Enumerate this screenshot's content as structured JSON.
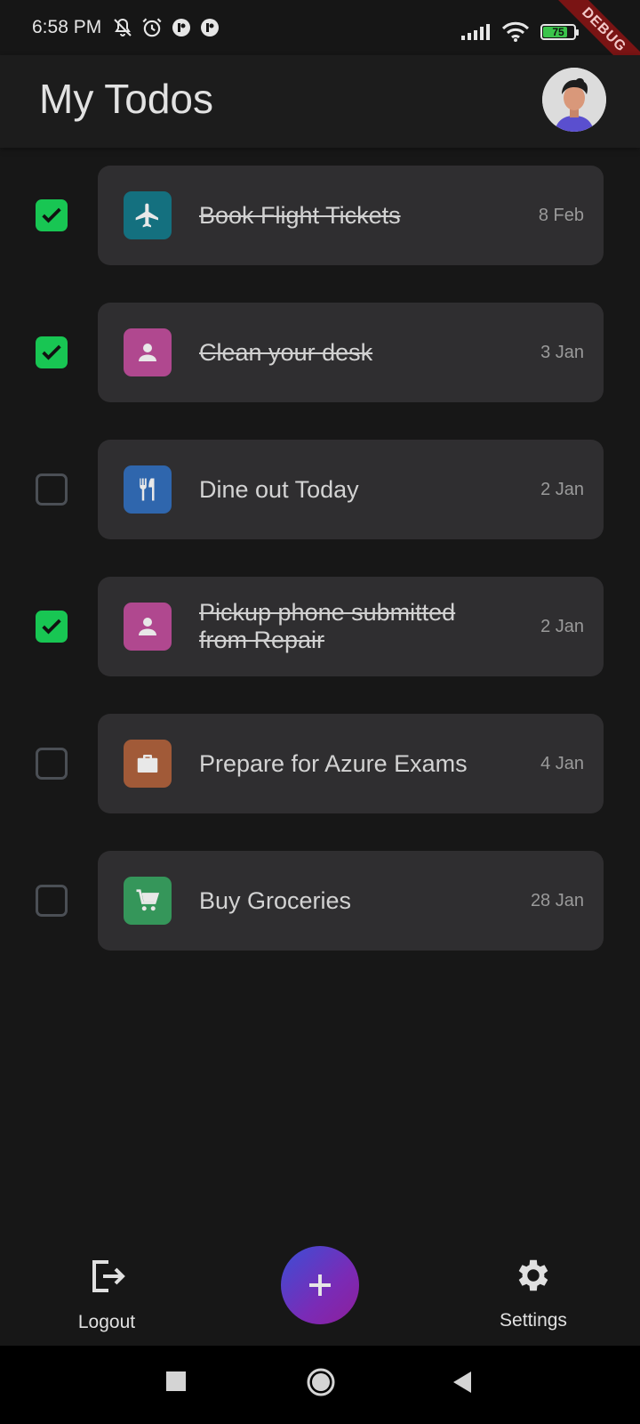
{
  "status_bar": {
    "time": "6:58 PM",
    "battery_level": "75",
    "battery_fraction": 0.75,
    "icons_left": [
      "bell-off-icon",
      "alarm-icon",
      "app-icon",
      "app-icon"
    ],
    "icons_right": [
      "signal-icon",
      "wifi-icon",
      "battery-icon"
    ]
  },
  "debug_banner": "DEBUG",
  "header": {
    "title": "My Todos",
    "avatar_icon": "avatar-icon"
  },
  "todos": [
    {
      "title": "Book Flight Tickets",
      "date": "8 Feb",
      "done": true,
      "icon": "airplane-icon",
      "color": "#14707f"
    },
    {
      "title": "Clean your desk",
      "date": "3 Jan",
      "done": true,
      "icon": "person-icon",
      "color": "#b0488f"
    },
    {
      "title": "Dine out Today",
      "date": "2 Jan",
      "done": false,
      "icon": "restaurant-icon",
      "color": "#2f66ad"
    },
    {
      "title": "Pickup phone submitted from Repair",
      "date": "2 Jan",
      "done": true,
      "icon": "person-icon",
      "color": "#b0488f"
    },
    {
      "title": "Prepare for Azure Exams",
      "date": "4 Jan",
      "done": false,
      "icon": "briefcase-icon",
      "color": "#a15a38"
    },
    {
      "title": "Buy Groceries",
      "date": "28 Jan",
      "done": false,
      "icon": "cart-icon",
      "color": "#35965a"
    }
  ],
  "bottom_nav": {
    "logout_label": "Logout",
    "settings_label": "Settings",
    "add_icon": "plus-icon"
  },
  "colors": {
    "background": "#171717",
    "card": "#2f2e30",
    "checkbox_checked": "#18c653",
    "fab_gradient_start": "#3b4fd6",
    "fab_gradient_end": "#8e1f9a"
  }
}
